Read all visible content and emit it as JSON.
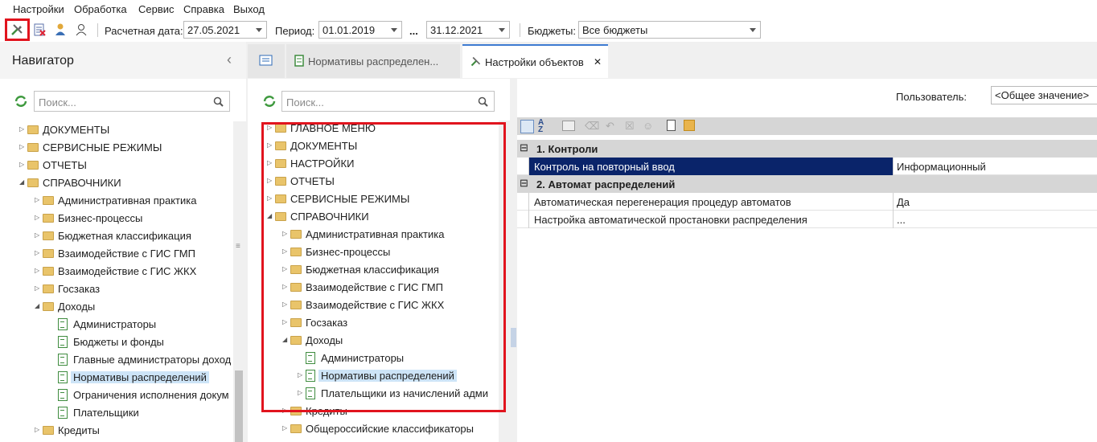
{
  "menu": [
    "Настройки",
    "Обработка",
    "Сервис",
    "Справка",
    "Выход"
  ],
  "toolbar": {
    "date_label": "Расчетная дата:",
    "date_value": "27.05.2021",
    "period_label": "Период:",
    "period_from": "01.01.2019",
    "period_sep": "...",
    "period_to": "31.12.2021",
    "budgets_label": "Бюджеты:",
    "budgets_value": "Все бюджеты",
    "icons": [
      "settings-objects-icon",
      "delete-doc-icon",
      "user-info-icon",
      "users-icon"
    ]
  },
  "navigator": {
    "title": "Навигатор",
    "search_placeholder": "Поиск...",
    "items": [
      {
        "label": "ДОКУМЕНТЫ",
        "type": "folder",
        "level": 0,
        "expanded": false
      },
      {
        "label": "СЕРВИСНЫЕ РЕЖИМЫ",
        "type": "folder",
        "level": 0,
        "expanded": false
      },
      {
        "label": "ОТЧЕТЫ",
        "type": "folder",
        "level": 0,
        "expanded": false
      },
      {
        "label": "СПРАВОЧНИКИ",
        "type": "folder",
        "level": 0,
        "expanded": true
      },
      {
        "label": "Административная практика",
        "type": "folder",
        "level": 1,
        "expanded": false
      },
      {
        "label": "Бизнес-процессы",
        "type": "folder",
        "level": 1,
        "expanded": false
      },
      {
        "label": "Бюджетная классификация",
        "type": "folder",
        "level": 1,
        "expanded": false
      },
      {
        "label": "Взаимодействие с ГИС ГМП",
        "type": "folder",
        "level": 1,
        "expanded": false
      },
      {
        "label": "Взаимодействие с ГИС ЖКХ",
        "type": "folder",
        "level": 1,
        "expanded": false
      },
      {
        "label": "Госзаказ",
        "type": "folder",
        "level": 1,
        "expanded": false
      },
      {
        "label": "Доходы",
        "type": "folder",
        "level": 1,
        "expanded": true
      },
      {
        "label": "Администраторы",
        "type": "doc",
        "level": 2
      },
      {
        "label": "Бюджеты и фонды",
        "type": "doc",
        "level": 2
      },
      {
        "label": "Главные администраторы доход",
        "type": "doc",
        "level": 2
      },
      {
        "label": "Нормативы распределений",
        "type": "doc",
        "level": 2,
        "selected": true
      },
      {
        "label": "Ограничения исполнения докум",
        "type": "doc",
        "level": 2
      },
      {
        "label": "Плательщики",
        "type": "doc",
        "level": 2
      },
      {
        "label": "Кредиты",
        "type": "folder",
        "level": 1,
        "expanded": false
      }
    ]
  },
  "tabs": [
    {
      "label": "",
      "icon": "list-icon"
    },
    {
      "label": "Нормативы распределен...",
      "icon": "doc-icon"
    },
    {
      "label": "Настройки объектов",
      "icon": "settings-objects-icon",
      "active": true,
      "close": "✕"
    }
  ],
  "objtree": {
    "search_placeholder": "Поиск...",
    "items": [
      {
        "label": "ГЛАВНОЕ МЕНЮ",
        "type": "folder",
        "level": 0,
        "expanded": false
      },
      {
        "label": "ДОКУМЕНТЫ",
        "type": "folder",
        "level": 0,
        "expanded": false
      },
      {
        "label": "НАСТРОЙКИ",
        "type": "folder",
        "level": 0,
        "expanded": false
      },
      {
        "label": "ОТЧЕТЫ",
        "type": "folder",
        "level": 0,
        "expanded": false
      },
      {
        "label": "СЕРВИСНЫЕ РЕЖИМЫ",
        "type": "folder",
        "level": 0,
        "expanded": false
      },
      {
        "label": "СПРАВОЧНИКИ",
        "type": "folder",
        "level": 0,
        "expanded": true
      },
      {
        "label": "Административная практика",
        "type": "folder",
        "level": 1,
        "expanded": false
      },
      {
        "label": "Бизнес-процессы",
        "type": "folder",
        "level": 1,
        "expanded": false
      },
      {
        "label": "Бюджетная классификация",
        "type": "folder",
        "level": 1,
        "expanded": false
      },
      {
        "label": "Взаимодействие с ГИС ГМП",
        "type": "folder",
        "level": 1,
        "expanded": false
      },
      {
        "label": "Взаимодействие с ГИС ЖКХ",
        "type": "folder",
        "level": 1,
        "expanded": false
      },
      {
        "label": "Госзаказ",
        "type": "folder",
        "level": 1,
        "expanded": false
      },
      {
        "label": "Доходы",
        "type": "folder",
        "level": 1,
        "expanded": true
      },
      {
        "label": "Администраторы",
        "type": "doc",
        "level": 2
      },
      {
        "label": "Нормативы распределений",
        "type": "doc",
        "level": 2,
        "selected": true,
        "expander": true
      },
      {
        "label": "Плательщики из начислений адми",
        "type": "doc",
        "level": 2,
        "expander": true
      },
      {
        "label": "Кредиты",
        "type": "folder",
        "level": 1,
        "expanded": false
      },
      {
        "label": "Общероссийские классификаторы",
        "type": "folder",
        "level": 1,
        "expanded": false
      }
    ]
  },
  "props": {
    "user_label": "Пользователь:",
    "user_value": "<Общее значение>",
    "groups": [
      {
        "title": "1. Контроли",
        "rows": [
          {
            "name": "Контроль на повторный ввод",
            "value": "Информационный",
            "selected": true
          }
        ]
      },
      {
        "title": "2. Автомат распределений",
        "rows": [
          {
            "name": "Автоматическая перегенерация процедур автоматов",
            "value": "Да"
          },
          {
            "name": "Настройка автоматической простановки распределения",
            "value": "..."
          }
        ]
      }
    ]
  },
  "colors": {
    "accent": "#0a246a",
    "selection": "#cde4f7",
    "highlight": "#e1141e",
    "tab_active_border": "#3d7bd1"
  }
}
